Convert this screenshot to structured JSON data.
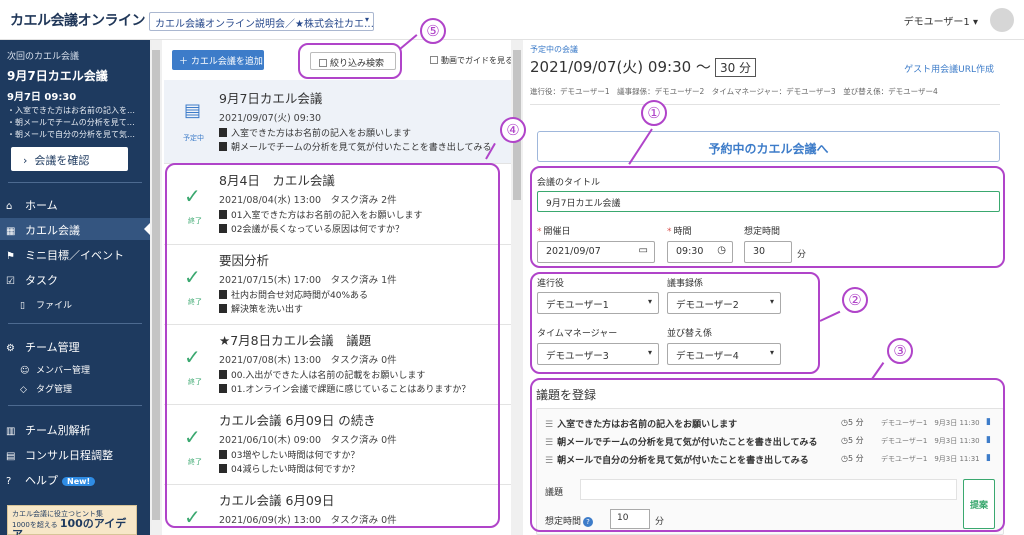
{
  "topbar": {
    "logo": "カエル会議オンライン",
    "meeting_select": "カエル会議オンライン説明会／★株式会社カエ…",
    "user_menu": "デモユーザー1 ▾"
  },
  "sidebar": {
    "next_label": "次回のカエル会議",
    "next_title": "9月7日カエル会議",
    "next_time": "9月7日 09:30",
    "next_items": [
      "・入室できた方はお名前の記入を…",
      "・朝メールでチームの分析を見て…",
      "・朝メールで自分の分析を見て気…"
    ],
    "confirm_button": "会議を確認",
    "nav": {
      "home": "ホーム",
      "meetings": "カエル会議",
      "mini_goals": "ミニ目標／イベント",
      "tasks": "タスク",
      "files": "ファイル",
      "team_mgmt": "チーム管理",
      "members": "メンバー管理",
      "tags": "タグ管理",
      "team_analysis": "チーム別解析",
      "consult_schedule": "コンサル日程調整",
      "help": "ヘルプ",
      "new_badge": "New!"
    },
    "banner": {
      "line1": "カエル会議に役立つヒント集",
      "line2_small": "1000を超える",
      "line2_big": "100のアイデア"
    }
  },
  "list": {
    "add_button": "＋ カエル会議を追加",
    "filter_button": "絞り込み検索",
    "guide_checkbox": "動画でガイドを見る",
    "meetings": [
      {
        "status": "予定中",
        "title": "9月7日カエル会議",
        "date": "2021/09/07(火) 09:30",
        "items": [
          "入室できた方はお名前の記入をお願いします",
          "朝メールでチームの分析を見て気が付いたことを書き出してみる"
        ]
      },
      {
        "status": "終了",
        "title": "8月4日　カエル会議",
        "date": "2021/08/04(水) 13:00　タスク済み 2件",
        "items": [
          "01入室できた方はお名前の記入をお願いします",
          "02会議が長くなっている原因は何ですか？"
        ]
      },
      {
        "status": "終了",
        "title": "要因分析",
        "date": "2021/07/15(木) 17:00　タスク済み 1件",
        "items": [
          "社内お問合せ対応時間が40%ある",
          "解決策を洗い出す"
        ]
      },
      {
        "status": "終了",
        "title": "★7月8日カエル会議　議題",
        "date": "2021/07/08(木) 13:00　タスク済み 0件",
        "items": [
          "00.入出ができた人は名前の記載をお願いします",
          "01.オンライン会議で課題に感じていることはありますか？"
        ]
      },
      {
        "status": "終了",
        "title": "カエル会議 6月09日 の続き",
        "date": "2021/06/10(木) 09:00　タスク済み 0件",
        "items": [
          "03増やしたい時間は何ですか？",
          "04減らしたい時間は何ですか？"
        ]
      },
      {
        "status": "終了",
        "title": "カエル会議 6月09日",
        "date": "2021/06/09(水) 13:00　タスク済み 0件",
        "items": []
      }
    ]
  },
  "detail": {
    "upcoming_label": "予定中の会議",
    "datetime": "2021/09/07(火) 09:30 ～",
    "duration": "30 分",
    "guest_link": "ゲスト用会議URL作成",
    "roles_line": "進行役：デモユーザー1　議事録係：デモユーザー2　タイムマネージャー：デモユーザー3　並び替え係：デモユーザー4",
    "to_meeting_button": "予約中のカエル会議へ",
    "title_label": "会議のタイトル",
    "title_value": "9月7日カエル会議",
    "date_label": "開催日",
    "date_value": "2021/09/07",
    "time_label": "時間",
    "time_value": "09:30",
    "est_label": "想定時間",
    "est_value": "30",
    "est_unit": "分",
    "roles": [
      {
        "label": "進行役",
        "value": "デモユーザー1"
      },
      {
        "label": "議事録係",
        "value": "デモユーザー2"
      },
      {
        "label": "タイムマネージャー",
        "value": "デモユーザー3"
      },
      {
        "label": "並び替え係",
        "value": "デモユーザー4"
      }
    ],
    "agenda_head": "議題を登録",
    "agenda_items": [
      {
        "text": "入室できた方はお名前の記入をお願いします",
        "duration": "5 分",
        "meta": "デモユーザー1　9月3日 11:30"
      },
      {
        "text": "朝メールでチームの分析を見て気が付いたことを書き出してみる",
        "duration": "5 分",
        "meta": "デモユーザー1　9月3日 11:30"
      },
      {
        "text": "朝メールで自分の分析を見て気が付いたことを書き出してみる",
        "duration": "5 分",
        "meta": "デモユーザー1　9月3日 11:31"
      }
    ],
    "agenda_input_label": "議題",
    "agenda_est_label": "想定時間",
    "agenda_est_value": "10",
    "agenda_est_unit": "分",
    "propose_button": "提案"
  },
  "callouts": [
    "①",
    "②",
    "③",
    "④",
    "⑤"
  ],
  "colors": {
    "sidebar_bg": "#1e3a5f",
    "primary": "#3d7cc9",
    "done_green": "#3aa86f",
    "callout": "#b044c9"
  }
}
